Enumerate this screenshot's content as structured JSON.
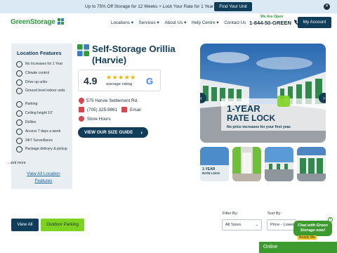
{
  "promo": {
    "text": "Up to 75% Off Storage for 12 Weeks + Lock Your Rate for 1 Year 🔒",
    "button": "Find Your Unit",
    "close": "✕"
  },
  "header": {
    "logo": "GreenStorage",
    "nav": [
      "Locations ▾",
      "Services ▾",
      "About Us ▾",
      "Help Centre ▾",
      "Contact Us"
    ],
    "open_label": "We Are Open",
    "phone": "1-844-50-GREEN",
    "account_button": "My Account"
  },
  "features": {
    "title": "Location Features",
    "items": [
      "No Increases for 1 Year",
      "Climate control",
      "Drive up units",
      "Ground level indoor units",
      "Parking",
      "Ceiling height 10'",
      "Dollies",
      "Access 7 days a week",
      "24/7 Surveillance",
      "Package delivery & pickup"
    ],
    "more": "... and more",
    "view_all": "View All Location Features"
  },
  "facility": {
    "title": "Self-Storage Orillia (Harvie)",
    "rating": "4.9",
    "stars": "★★★★★",
    "rating_label": "average rating",
    "google_letter": "G",
    "address": "575 Harvie Settlement Rd.",
    "phone": "(705) 325-9861",
    "email_label": "Email",
    "hours_label": "Store Hours",
    "size_guide_button": "VIEW OUR SIZE GUIDE",
    "size_guide_arrow": "›"
  },
  "hero": {
    "headline_line1": "1-YEAR",
    "headline_line2": "RATE LOCK",
    "subline": "No price increases for your first year.",
    "prev": "‹",
    "next": "›"
  },
  "thumbnails": {
    "first_label_line1": "1-YEAR",
    "first_label_line2": "RATE LOCK"
  },
  "filters": {
    "tab_all": "View All",
    "tab_outdoor": "Outdoor Parking",
    "filter_by_label": "Filter By:",
    "filter_by_value": "All Sizes",
    "sort_by_label": "Sort By:",
    "sort_by_value": "Price - Lowest",
    "chevron": "⌄"
  },
  "chat": {
    "bubble": "Chat with Green Storage now!",
    "close": "✕",
    "tag": "Ready Me",
    "online": "Online"
  },
  "colors": {
    "navy": "#0f3d5a",
    "green": "#2f9a3e",
    "lime": "#7ed321",
    "promo_bg": "#dbe9f4",
    "sidebar_bg": "#e9eef2",
    "icon_red": "#d8454d"
  }
}
